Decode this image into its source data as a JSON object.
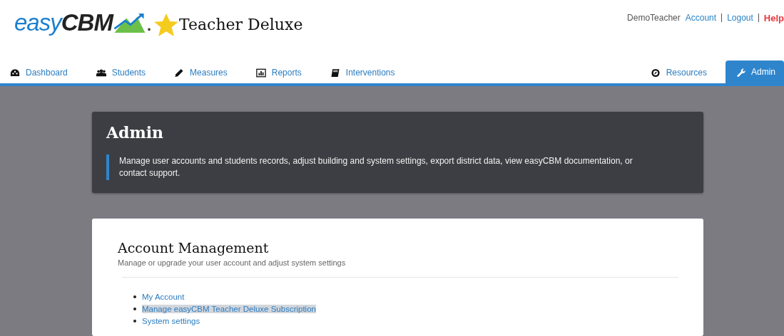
{
  "header": {
    "logo": {
      "part_1": "easy",
      "part_2": "CBM",
      "suffix": "."
    },
    "product": "Teacher Deluxe",
    "user": "DemoTeacher",
    "links": [
      {
        "label": "Account",
        "kind": "link"
      },
      {
        "label": "Logout",
        "kind": "link"
      },
      {
        "label": "Help",
        "kind": "help"
      }
    ]
  },
  "nav": {
    "left": [
      {
        "label": "Dashboard",
        "kind": "dashboard",
        "selected": false
      },
      {
        "label": "Students",
        "kind": "students",
        "selected": false
      },
      {
        "label": "Measures",
        "kind": "pencil",
        "selected": false
      },
      {
        "label": "Reports",
        "kind": "chart",
        "selected": false
      },
      {
        "label": "Interventions",
        "kind": "book",
        "selected": false
      }
    ],
    "right": [
      {
        "label": "Resources",
        "kind": "compass",
        "selected": false
      },
      {
        "label": "Admin",
        "kind": "wrench",
        "selected": true
      }
    ]
  },
  "banner": {
    "title": "Admin",
    "description": "Manage user accounts and students records, adjust building and system settings, export district data, view easyCBM documentation, or contact support."
  },
  "card": {
    "title": "Account Management",
    "subtitle": "Manage or upgrade your user account and adjust system settings",
    "links": [
      {
        "label": "My Account",
        "highlighted": false
      },
      {
        "label": "Manage easyCBM Teacher Deluxe Subscription",
        "highlighted": true
      },
      {
        "label": "System settings",
        "highlighted": false
      }
    ]
  }
}
